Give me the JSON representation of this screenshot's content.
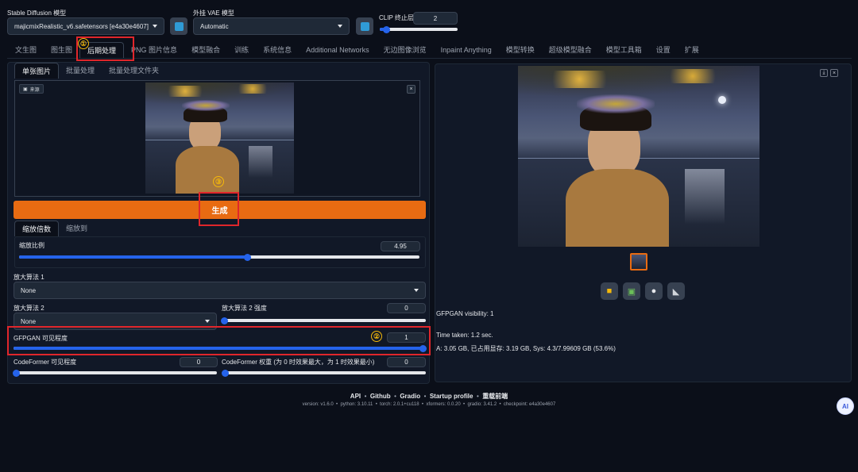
{
  "header": {
    "model_label": "Stable Diffusion 模型",
    "model_value": "majicmixRealistic_v6.safetensors [e4a30e4607]",
    "vae_label": "外挂 VAE 模型",
    "vae_value": "Automatic",
    "clip_label": "CLIP 终止层数",
    "clip_value": "2",
    "clip_fraction": 0.08
  },
  "main_tabs": [
    "文生图",
    "图生图",
    "后期处理",
    "PNG 图片信息",
    "模型融合",
    "训练",
    "系统信息",
    "Additional Networks",
    "无边图像浏览",
    "Inpaint Anything",
    "模型转换",
    "超级模型融合",
    "模型工具箱",
    "设置",
    "扩展"
  ],
  "sub_tabs": [
    "单张图片",
    "批量处理",
    "批量处理文件夹"
  ],
  "source_label": "来源",
  "generate_label": "生成",
  "scale_tabs": [
    "缩放倍数",
    "缩放到"
  ],
  "scale": {
    "label": "缩放比例",
    "value": "4.95",
    "fraction": 0.57
  },
  "upscaler1": {
    "label": "放大算法 1",
    "value": "None"
  },
  "upscaler2": {
    "label": "放大算法 2",
    "value": "None"
  },
  "upscaler2_strength": {
    "label": "放大算法 2 强度",
    "value": "0",
    "fraction": 0.0
  },
  "gfpgan": {
    "label": "GFPGAN 可见程度",
    "value": "1",
    "fraction": 1.0
  },
  "codeformer": {
    "label": "CodeFormer 可见程度",
    "value": "0",
    "fraction": 0.0
  },
  "codeformer_weight": {
    "label": "CodeFormer 权重 (为 0 时效果最大，为 1 时效果最小)",
    "value": "0",
    "fraction": 0.0
  },
  "annotations": [
    "①",
    "②",
    "③"
  ],
  "output": {
    "gfpgan_info": "GFPGAN visibility: 1",
    "time_taken": "Time taken: 1.2 sec.",
    "memory": "A: 3.05 GB, 已占用显存: 3.19 GB, Sys: 4.3/7.99609 GB (53.6%)"
  },
  "footer": {
    "links": [
      "API",
      "Github",
      "Gradio",
      "Startup profile",
      "重载前端"
    ],
    "version": "version: v1.6.0  •  python: 3.10.11  •  torch: 2.0.1+cu118  •  xformers: 0.0.20  •  gradio: 3.41.2  •  checkpoint: e4a30e4607"
  },
  "floating_badge": "AI"
}
